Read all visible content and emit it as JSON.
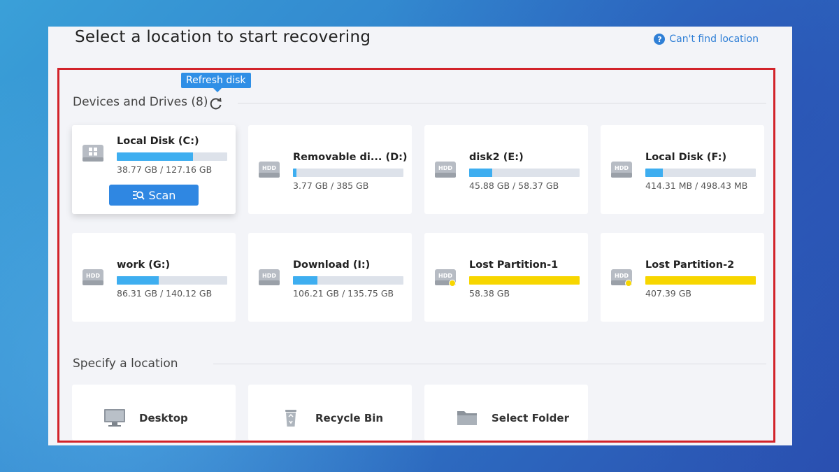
{
  "header": {
    "title": "Select a location to start recovering",
    "help_link": "Can't find location",
    "help_icon": "?"
  },
  "tooltip": "Refresh disk",
  "devices_section": {
    "title": "Devices and Drives (8)"
  },
  "drives": [
    {
      "name": "Local Disk (C:)",
      "size": "38.77 GB / 127.16 GB",
      "used_fraction": 0.69,
      "color": "#3eaef0",
      "icon": "windows-drive-icon"
    },
    {
      "name": "Removable di... (D:)",
      "size": "3.77 GB / 385 GB",
      "used_fraction": 0.03,
      "color": "#3eaef0",
      "icon": "hdd-icon"
    },
    {
      "name": "disk2 (E:)",
      "size": "45.88 GB / 58.37 GB",
      "used_fraction": 0.21,
      "color": "#3eaef0",
      "icon": "hdd-icon"
    },
    {
      "name": "Local Disk (F:)",
      "size": "414.31 MB / 498.43 MB",
      "used_fraction": 0.16,
      "color": "#3eaef0",
      "icon": "hdd-icon"
    },
    {
      "name": "work (G:)",
      "size": "86.31 GB / 140.12 GB",
      "used_fraction": 0.38,
      "color": "#3eaef0",
      "icon": "hdd-icon"
    },
    {
      "name": "Download (I:)",
      "size": "106.21 GB / 135.75 GB",
      "used_fraction": 0.22,
      "color": "#3eaef0",
      "icon": "hdd-icon"
    },
    {
      "name": "Lost Partition-1",
      "size": "58.38 GB",
      "used_fraction": 1.0,
      "color": "#f7d600",
      "icon": "lost-partition-hdd-icon"
    },
    {
      "name": "Lost Partition-2",
      "size": "407.39 GB",
      "used_fraction": 1.0,
      "color": "#f7d600",
      "icon": "lost-partition-hdd-icon"
    }
  ],
  "scan_button": "Scan",
  "location_section": {
    "title": "Specify a location"
  },
  "locations": [
    {
      "label": "Desktop",
      "icon": "monitor-icon"
    },
    {
      "label": "Recycle Bin",
      "icon": "recycle-bin-icon"
    },
    {
      "label": "Select Folder",
      "icon": "folder-icon"
    }
  ],
  "colors": {
    "accent": "#2f87e2",
    "highlight_border": "#d2232a",
    "lost_partition": "#f7d600"
  }
}
